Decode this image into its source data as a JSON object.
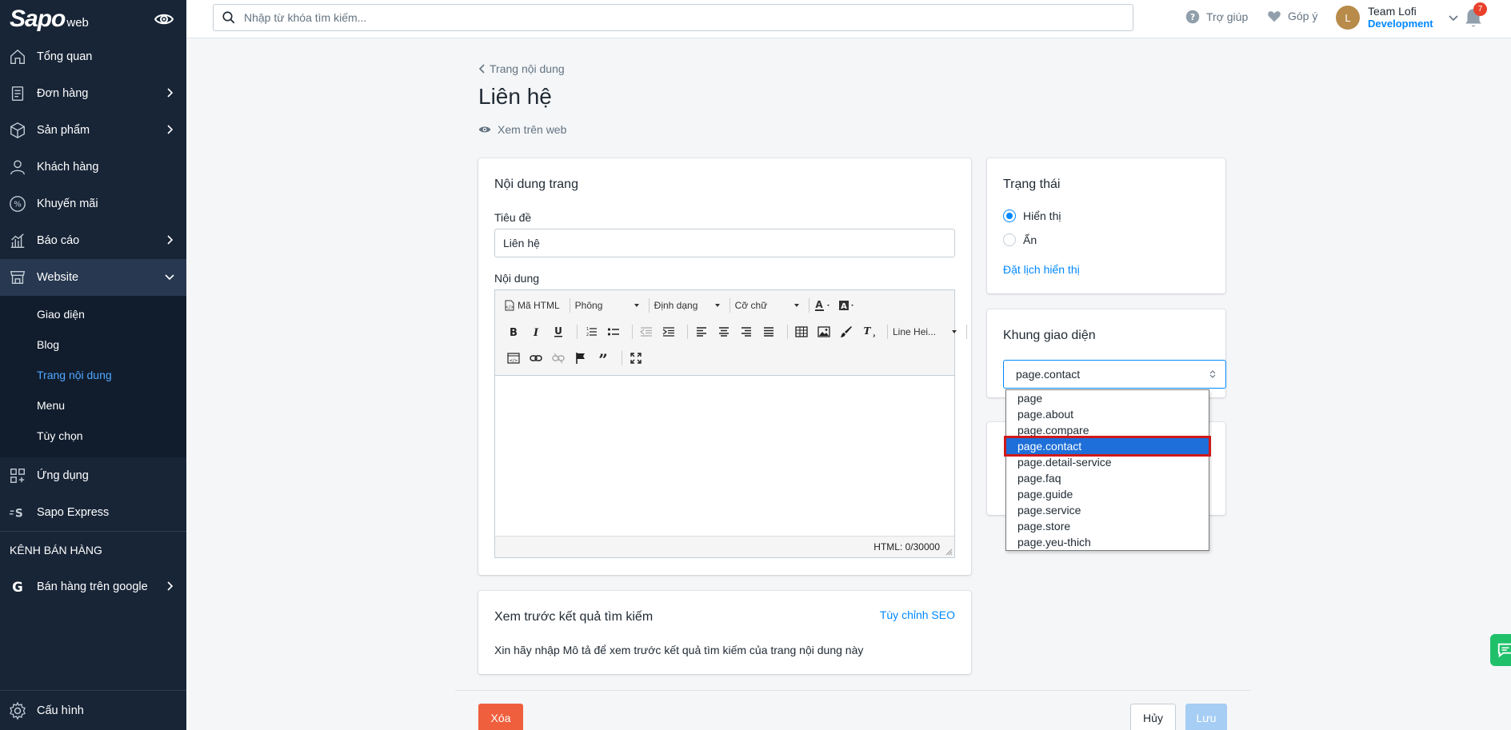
{
  "brand": {
    "logo": "Sapo",
    "logo_suffix": "web"
  },
  "sidebar": {
    "items": [
      {
        "label": "Tổng quan"
      },
      {
        "label": "Đơn hàng"
      },
      {
        "label": "Sản phẩm"
      },
      {
        "label": "Khách hàng"
      },
      {
        "label": "Khuyến mãi"
      },
      {
        "label": "Báo cáo"
      },
      {
        "label": "Website"
      }
    ],
    "website_sub": [
      {
        "label": "Giao diện"
      },
      {
        "label": "Blog"
      },
      {
        "label": "Trang nội dung"
      },
      {
        "label": "Menu"
      },
      {
        "label": "Tùy chọn"
      }
    ],
    "apps_label": "Ứng dụng",
    "express_label": "Sapo Express",
    "channels_heading": "KÊNH BÁN HÀNG",
    "google_label": "Bán hàng trên google",
    "settings_label": "Cấu hình"
  },
  "topbar": {
    "search_placeholder": "Nhập từ khóa tìm kiếm...",
    "help_label": "Trợ giúp",
    "feedback_label": "Góp ý",
    "user_initial": "L",
    "user_name": "Team Lofi",
    "user_role": "Development",
    "notification_count": "7"
  },
  "page": {
    "breadcrumb": "Trang nội dung",
    "title": "Liên hệ",
    "view_on_web": "Xem trên web"
  },
  "content_card": {
    "title": "Nội dung trang",
    "title_label": "Tiêu đề",
    "title_value": "Liên hệ",
    "content_label": "Nội dung",
    "toolbar": {
      "html_btn": "Mã HTML",
      "font_drop": "Phông",
      "format_drop": "Định dạng",
      "size_drop": "Cỡ chữ",
      "line_height_drop": "Line Hei..."
    },
    "status": "HTML: 0/30000"
  },
  "seo_card": {
    "title": "Xem trước kết quả tìm kiếm",
    "customize_link": "Tùy chỉnh SEO",
    "hint": "Xin hãy nhập Mô tả để xem trước kết quả tìm kiếm của trang nội dung này"
  },
  "status_card": {
    "title": "Trạng thái",
    "option_show": "Hiển thị",
    "option_hide": "Ẩn",
    "selected": "Hiển thị",
    "schedule_link": "Đặt lịch hiển thị"
  },
  "template_card": {
    "title": "Khung giao diện",
    "selected": "page.contact",
    "options": [
      "page",
      "page.about",
      "page.compare",
      "page.contact",
      "page.detail-service",
      "page.faq",
      "page.guide",
      "page.service",
      "page.store",
      "page.yeu-thich"
    ]
  },
  "actions": {
    "delete": "Xóa",
    "cancel": "Hủy",
    "save": "Lưu"
  },
  "colors": {
    "sidebar_bg": "#182537",
    "accent": "#0088ff",
    "danger": "#f05f3d",
    "highlight_border": "#d01919"
  }
}
